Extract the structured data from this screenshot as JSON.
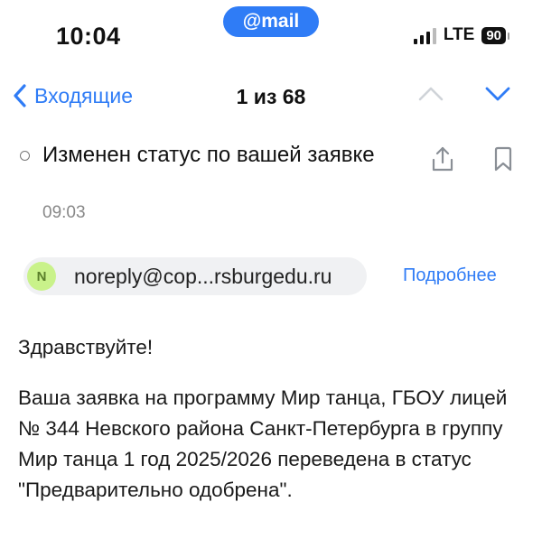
{
  "status_bar": {
    "time": "10:04",
    "mail_pill": "@mail",
    "network": "LTE",
    "battery": "90"
  },
  "nav": {
    "back_label": "Входящие",
    "counter": "1 из 68"
  },
  "message": {
    "subject": "Изменен статус по вашей заявке",
    "time": "09:03",
    "sender_initial": "N",
    "sender_email": "noreply@cop...rsburgedu.ru",
    "details_link": "Подробнее",
    "greeting": "Здравствуйте!",
    "body": "Ваша заявка на программу Мир танца, ГБОУ лицей № 344 Невского района Санкт-Петербурга в группу Мир танца 1 год 2025/2026 переведена в статус \"Предварительно одобрена\"."
  },
  "colors": {
    "accent": "#2f7cf6",
    "avatar_bg": "#c9f28a",
    "chip_bg": "#f0f1f3"
  },
  "icons": [
    "chevron-left-icon",
    "chevron-up-icon",
    "chevron-down-icon",
    "share-icon",
    "bookmark-icon"
  ]
}
